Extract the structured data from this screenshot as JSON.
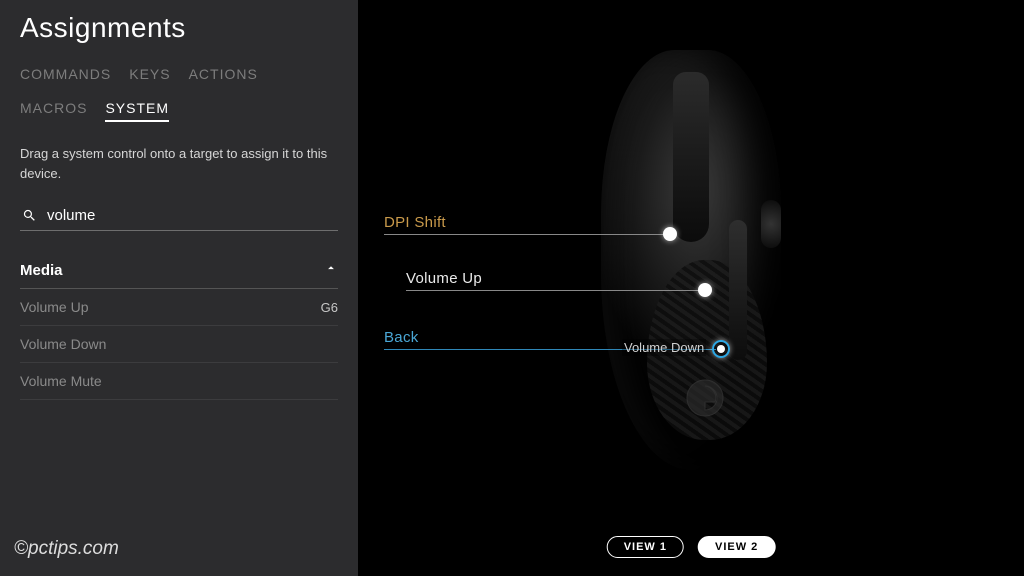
{
  "title": "Assignments",
  "tabs": {
    "commands": "COMMANDS",
    "keys": "KEYS",
    "actions": "ACTIONS",
    "macros": "MACROS",
    "system": "SYSTEM",
    "active": "system"
  },
  "instruction": "Drag a system control onto a target to assign it to this device.",
  "search": {
    "value": "volume",
    "placeholder": "Search"
  },
  "category": {
    "label": "Media",
    "expanded": true,
    "items": [
      {
        "label": "Volume Up",
        "assigned": "G6"
      },
      {
        "label": "Volume Down",
        "assigned": ""
      },
      {
        "label": "Volume Mute",
        "assigned": ""
      }
    ]
  },
  "callouts": {
    "dpi": "DPI Shift",
    "volup": "Volume Up",
    "back": "Back"
  },
  "dragging_label": "Volume Down",
  "views": {
    "view1": "VIEW 1",
    "view2": "VIEW 2",
    "active": "view2"
  },
  "watermark": "©pctips.com",
  "colors": {
    "accent_gold": "#c99a4b",
    "accent_blue": "#2ea8e5",
    "sidebar_bg": "#2c2c2e"
  }
}
